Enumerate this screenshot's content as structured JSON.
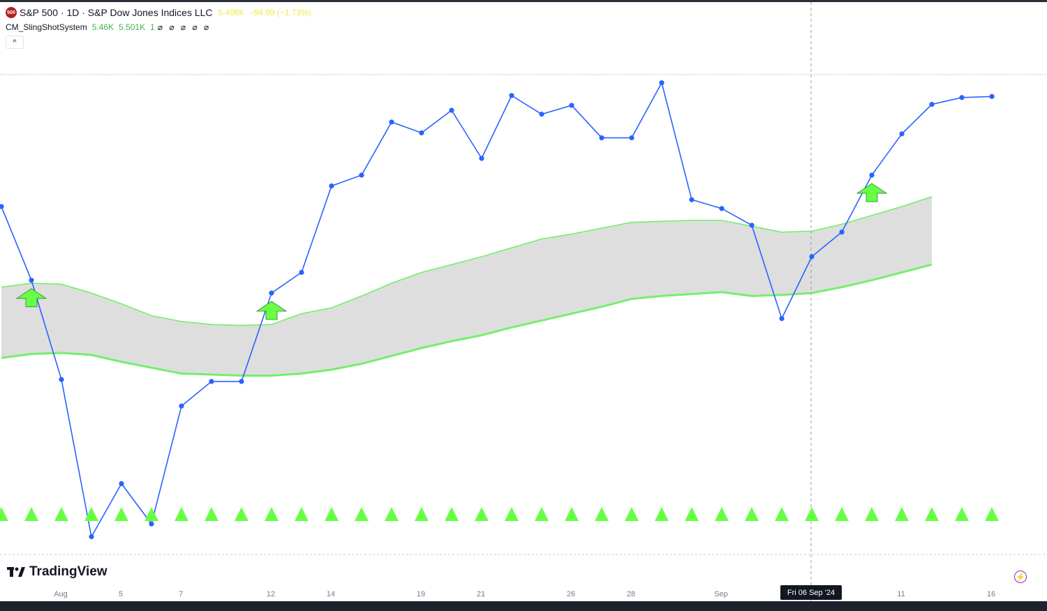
{
  "header": {
    "symbol_badge": "500",
    "title": "S&P 500 · 1D · S&P Dow Jones Indices LLC",
    "last_value": "5.408K",
    "change": "−94.99 (−1.73%)"
  },
  "indicator": {
    "name": "CM_SlingShotSystem",
    "value1": "5.46K",
    "value2": "5.501K",
    "value3": "1",
    "placeholders": "⌀ ⌀ ⌀ ⌀ ⌀",
    "collapse_icon": "chevron-up-icon"
  },
  "branding": {
    "logo_text": "TradingView"
  },
  "crosshair": {
    "date_label": "Fri 06 Sep '24"
  },
  "colors": {
    "price_line": "#2962ff",
    "ema_band": "#76ee6c",
    "band_fill": "#dedede",
    "arrow": "#66ff44",
    "triangle": "#66ff44"
  },
  "chart_data": {
    "type": "line",
    "title": "S&P 500 · 1D · S&P Dow Jones Indices LLC",
    "x_tick_labels": [
      "Aug",
      "5",
      "7",
      "12",
      "14",
      "19",
      "21",
      "26",
      "28",
      "Sep",
      "11",
      "16"
    ],
    "x": [
      "Jul 31",
      "Aug 1",
      "Aug 2",
      "Aug 5",
      "Aug 6",
      "Aug 7",
      "Aug 8",
      "Aug 9",
      "Aug 12",
      "Aug 13",
      "Aug 14",
      "Aug 15",
      "Aug 16",
      "Aug 19",
      "Aug 20",
      "Aug 21",
      "Aug 22",
      "Aug 23",
      "Aug 26",
      "Aug 27",
      "Aug 28",
      "Aug 29",
      "Aug 30",
      "Sep 3",
      "Sep 4",
      "Sep 5",
      "Sep 6",
      "Sep 9",
      "Sep 10",
      "Sep 11",
      "Sep 12",
      "Sep 13",
      "Sep 16",
      "Sep 17"
    ],
    "series": [
      {
        "name": "S&P 500",
        "values": [
          5522,
          5447,
          5346,
          5186,
          5240,
          5199,
          5319,
          5344,
          5344,
          5434,
          5455,
          5543,
          5554,
          5608,
          5597,
          5620,
          5571,
          5635,
          5616,
          5625,
          5592,
          5592,
          5648,
          5529,
          5520,
          5503,
          5408,
          5471,
          5496,
          5554,
          5596,
          5626,
          5633,
          5634
        ]
      },
      {
        "name": "EMA fast",
        "values": [
          5440,
          5444,
          5443,
          5434,
          5423,
          5411,
          5405,
          5402,
          5401,
          5402,
          5413,
          5419,
          5431,
          5444,
          5455,
          5463,
          5471,
          5480,
          5489,
          5494,
          5500,
          5506,
          5507,
          5508,
          5508,
          5502,
          5496,
          5497,
          5504,
          5513,
          5522,
          5532
        ]
      },
      {
        "name": "EMA slow",
        "values": [
          5368,
          5372,
          5373,
          5371,
          5364,
          5358,
          5352,
          5351,
          5350,
          5350,
          5352,
          5356,
          5362,
          5370,
          5378,
          5385,
          5391,
          5399,
          5406,
          5413,
          5420,
          5428,
          5431,
          5433,
          5435,
          5431,
          5432,
          5434,
          5440,
          5447,
          5455,
          5463
        ]
      }
    ],
    "up_arrows_at": [
      "Aug 1",
      "Aug 13",
      "Sep 11"
    ],
    "up_triangles": "every bar",
    "ylim": [
      5170,
      5690
    ],
    "grid": false,
    "legend": "top-left"
  }
}
